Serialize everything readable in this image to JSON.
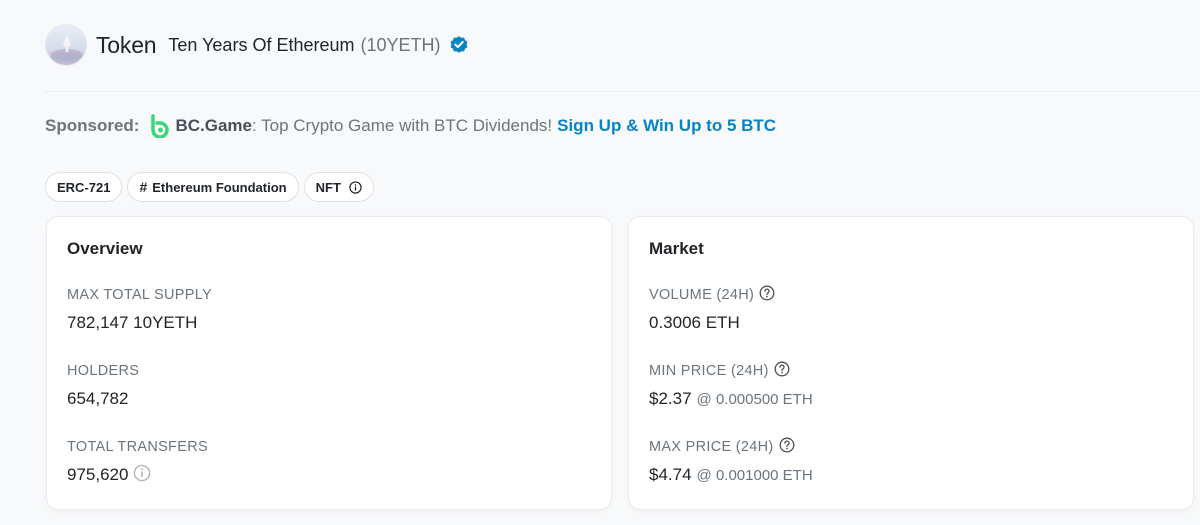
{
  "header": {
    "page_title": "Token",
    "token_name": "Ten Years Of Ethereum",
    "token_symbol": "(10YETH)",
    "verified_icon": "verified-check-icon"
  },
  "sponsored": {
    "label": "Sponsored:",
    "brand": "BC.Game",
    "text": ": Top Crypto Game with BTC Dividends!",
    "link": "Sign Up & Win Up to 5 BTC"
  },
  "tags": {
    "standard": "ERC-721",
    "foundation": "Ethereum Foundation",
    "nft": "NFT"
  },
  "overview": {
    "title": "Overview",
    "max_total_supply_label": "MAX TOTAL SUPPLY",
    "max_total_supply_value": "782,147 10YETH",
    "holders_label": "HOLDERS",
    "holders_value": "654,782",
    "total_transfers_label": "TOTAL TRANSFERS",
    "total_transfers_value": "975,620"
  },
  "market": {
    "title": "Market",
    "volume_label": "VOLUME (24H)",
    "volume_value": "0.3006 ETH",
    "min_price_label": "MIN PRICE (24H)",
    "min_price_value": "$2.37",
    "min_price_eth": "@ 0.000500 ETH",
    "max_price_label": "MAX PRICE (24H)",
    "max_price_value": "$4.74",
    "max_price_eth": "@ 0.001000 ETH"
  },
  "colors": {
    "link_blue": "#0784c3",
    "muted_text": "#6c757d",
    "bc_green": "#3ad67a"
  }
}
